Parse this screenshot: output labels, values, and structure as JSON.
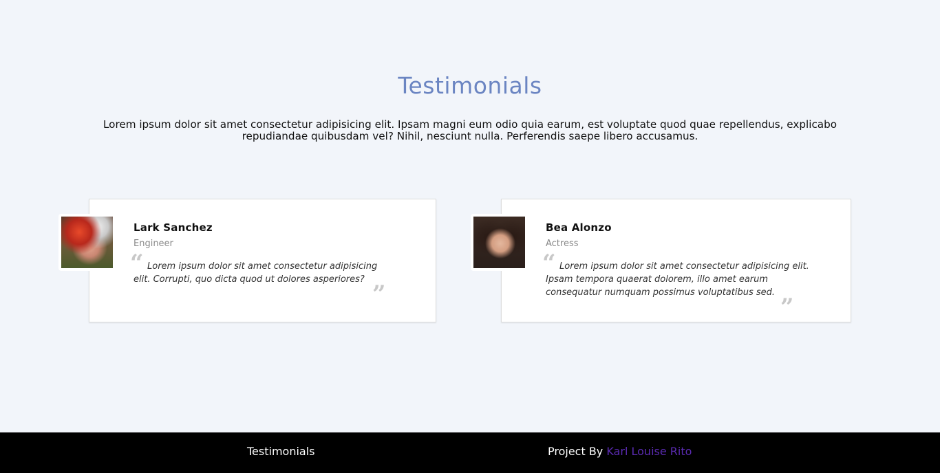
{
  "section": {
    "title": "Testimonials",
    "intro": "Lorem ipsum dolor sit amet consectetur adipisicing elit. Ipsam magni eum odio quia earum, est voluptate quod quae repellendus, explicabo repudiandae quibusdam vel? Nihil, nesciunt nulla. Perferendis saepe libero accusamus."
  },
  "testimonials": [
    {
      "name": "Lark Sanchez",
      "role": "Engineer",
      "quote": "Lorem ipsum dolor sit amet consectetur adipisicing elit. Corrupti, quo dicta quod ut dolores asperiores?",
      "open_mark": "“",
      "close_mark": "”"
    },
    {
      "name": "Bea Alonzo",
      "role": "Actress",
      "quote": "Lorem ipsum dolor sit amet consectetur adipisicing elit. Ipsam tempora quaerat dolorem, illo amet earum consequatur numquam possimus voluptatibus sed.",
      "open_mark": "“",
      "close_mark": "”"
    }
  ],
  "footer": {
    "title": "Testimonials",
    "credit_prefix": "Project By",
    "author": "Karl Louise Rito"
  },
  "colors": {
    "title": "#6b85c2",
    "background": "#f2f5fa",
    "footer": "#000000",
    "author_link": "#5b2bb3"
  }
}
